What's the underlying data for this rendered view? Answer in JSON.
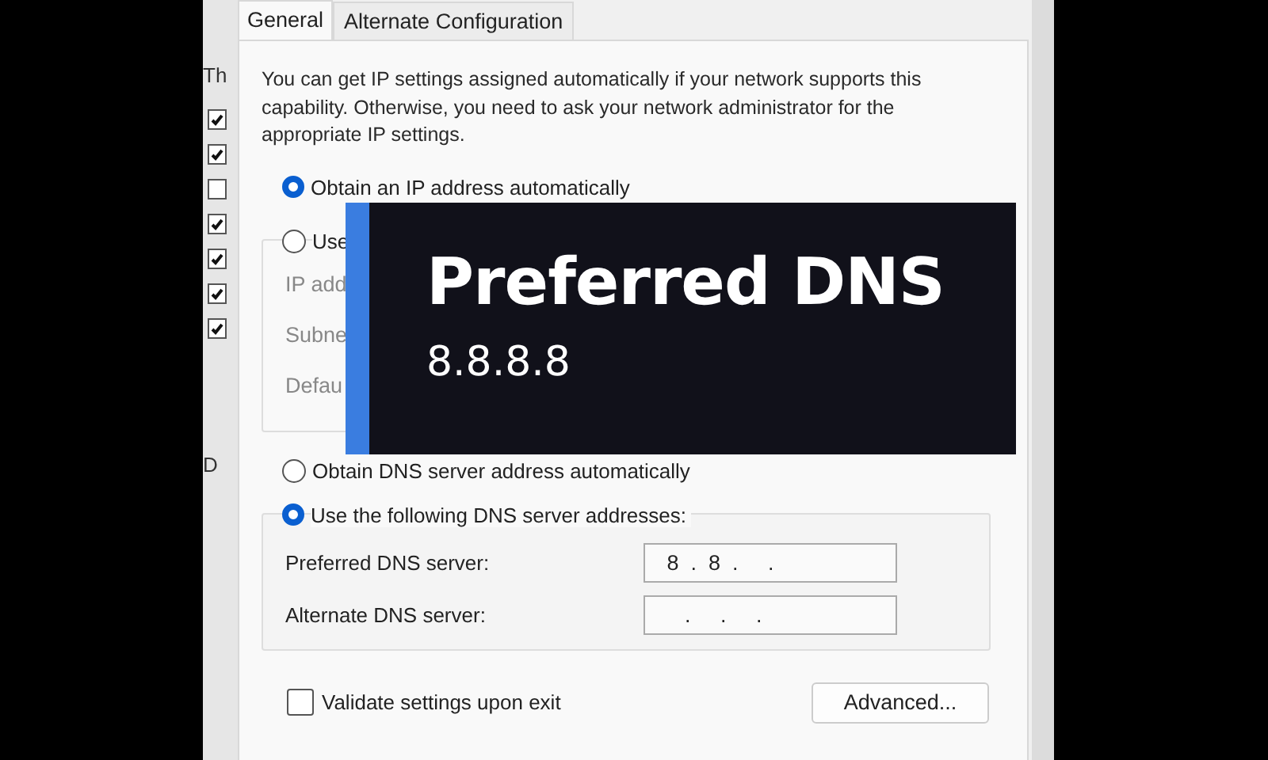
{
  "background_window": {
    "texts": [
      "Th",
      "D"
    ],
    "checkboxes": [
      {
        "checked": true
      },
      {
        "checked": true
      },
      {
        "checked": false
      },
      {
        "checked": true
      },
      {
        "checked": true
      },
      {
        "checked": true
      },
      {
        "checked": true
      }
    ]
  },
  "tabs": [
    {
      "label": "General",
      "selected": true
    },
    {
      "label": "Alternate Configuration",
      "selected": false
    }
  ],
  "description": "You can get IP settings assigned automatically if your network supports this capability. Otherwise, you need to ask your network administrator for the appropriate IP settings.",
  "ip_options": [
    {
      "label": "Obtain an IP address automatically",
      "selected": true
    },
    {
      "label": "Use",
      "selected": false
    }
  ],
  "ip_fields": [
    {
      "label": "IP add"
    },
    {
      "label": "Subne"
    },
    {
      "label": "Defau"
    }
  ],
  "dns_options": [
    {
      "label": "Obtain DNS server address automatically",
      "selected": false
    },
    {
      "label": "Use the following DNS server addresses:",
      "selected": true
    }
  ],
  "dns_fields": [
    {
      "label": "Preferred DNS server:",
      "value": " 8  .  8  .     ."
    },
    {
      "label": "Alternate DNS server:",
      "value": "    .     .     ."
    }
  ],
  "validate": {
    "label": "Validate settings upon exit",
    "checked": false
  },
  "advanced_button": "Advanced...",
  "caption": {
    "title": "Preferred DNS",
    "subtitle": "8.8.8.8"
  }
}
